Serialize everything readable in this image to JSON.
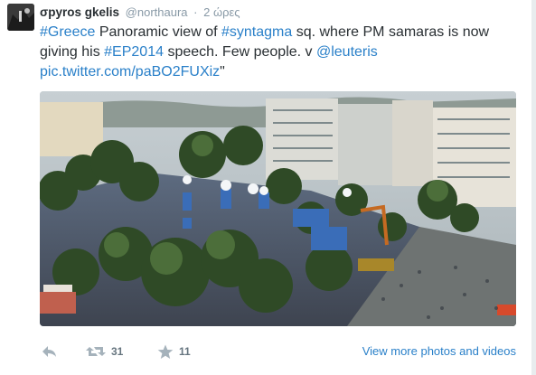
{
  "tweet": {
    "author": {
      "name": "σpyros gkelis",
      "handle": "@northaura",
      "time": "2 ώρες"
    },
    "text_segments": [
      {
        "text": "#Greece",
        "link": true
      },
      {
        "text": " Panoramic view of ",
        "link": false
      },
      {
        "text": "#syntagma",
        "link": true
      },
      {
        "text": " sq. where PM samaras is now giving his ",
        "link": false
      },
      {
        "text": "#EP2014",
        "link": true
      },
      {
        "text": " speech. Few people. v ",
        "link": false
      },
      {
        "text": "@leuteris",
        "link": true
      },
      {
        "text": " ",
        "link": false
      },
      {
        "text": "pic.twitter.com/paBO2FUXiz",
        "link": true
      },
      {
        "text": "\"",
        "link": false
      }
    ],
    "actions": {
      "reply_icon": "reply-icon",
      "retweet_icon": "retweet-icon",
      "retweet_count": "31",
      "favorite_icon": "star-icon",
      "favorite_count": "11",
      "view_more": "View more photos and videos"
    },
    "colors": {
      "link": "#2a80c9",
      "muted": "#8899a6",
      "text": "#292f33"
    }
  }
}
